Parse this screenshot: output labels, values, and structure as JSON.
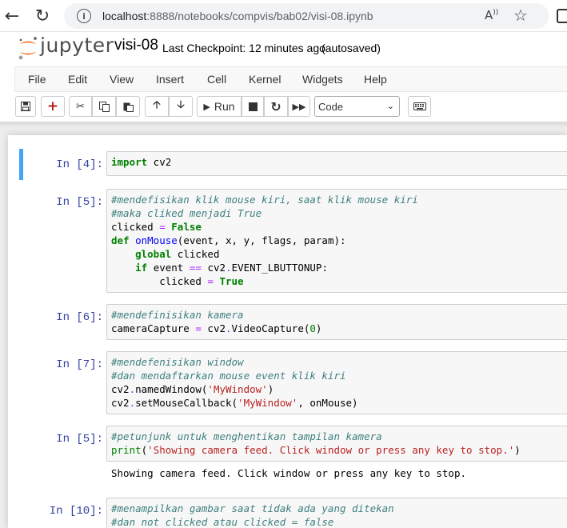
{
  "browser": {
    "url_host": "localhost",
    "url_path": ":8888/notebooks/compvis/bab02/visi-08.ipynb"
  },
  "header": {
    "logo_text": "jupyter",
    "notebook_name": "visi-08",
    "checkpoint": "Last Checkpoint: 12 minutes ago",
    "save_status": "(autosaved)"
  },
  "menu": [
    "File",
    "Edit",
    "View",
    "Insert",
    "Cell",
    "Kernel",
    "Widgets",
    "Help"
  ],
  "toolbar": {
    "run_label": "Run",
    "cell_type": "Code"
  },
  "cells": [
    {
      "prompt": "In [4]:",
      "lines": [
        [
          [
            "k",
            "import"
          ],
          [
            "",
            " cv2"
          ]
        ]
      ]
    },
    {
      "prompt": "In [5]:",
      "lines": [
        [
          [
            "c",
            "#mendefisikan klik mouse kiri, saat klik mouse kiri"
          ]
        ],
        [
          [
            "c",
            "#maka cliked menjadi True"
          ]
        ],
        [
          [
            "",
            "clicked "
          ],
          [
            "o",
            "="
          ],
          [
            "",
            " "
          ],
          [
            "k",
            "False"
          ]
        ],
        [
          [
            "k",
            "def"
          ],
          [
            "",
            " "
          ],
          [
            "f",
            "onMouse"
          ],
          [
            "",
            "(event, x, y, flags, param):"
          ]
        ],
        [
          [
            "",
            "    "
          ],
          [
            "k",
            "global"
          ],
          [
            "",
            " clicked"
          ]
        ],
        [
          [
            "",
            "    "
          ],
          [
            "k",
            "if"
          ],
          [
            "",
            " event "
          ],
          [
            "o",
            "=="
          ],
          [
            "",
            " cv2"
          ],
          [
            "o",
            "."
          ],
          [
            "",
            "EVENT_LBUTTONUP:"
          ]
        ],
        [
          [
            "",
            "        clicked "
          ],
          [
            "o",
            "="
          ],
          [
            "",
            " "
          ],
          [
            "k",
            "True"
          ]
        ]
      ]
    },
    {
      "prompt": "In [6]:",
      "lines": [
        [
          [
            "c",
            "#mendefinisikan kamera"
          ]
        ],
        [
          [
            "",
            "cameraCapture "
          ],
          [
            "o",
            "="
          ],
          [
            "",
            " cv2"
          ],
          [
            "o",
            "."
          ],
          [
            "",
            "VideoCapture("
          ],
          [
            "n",
            "0"
          ],
          [
            "",
            ")"
          ]
        ]
      ]
    },
    {
      "prompt": "In [7]:",
      "lines": [
        [
          [
            "c",
            "#mendefenisikan window"
          ]
        ],
        [
          [
            "c",
            "#dan mendaftarkan mouse event klik kiri"
          ]
        ],
        [
          [
            "",
            "cv2"
          ],
          [
            "o",
            "."
          ],
          [
            "",
            "namedWindow("
          ],
          [
            "s",
            "'MyWindow'"
          ],
          [
            "",
            ")"
          ]
        ],
        [
          [
            "",
            "cv2"
          ],
          [
            "o",
            "."
          ],
          [
            "",
            "setMouseCallback("
          ],
          [
            "s",
            "'MyWindow'"
          ],
          [
            "",
            ", onMouse)"
          ]
        ]
      ]
    },
    {
      "prompt": "In [5]:",
      "lines": [
        [
          [
            "c",
            "#petunjunk untuk menghentikan tampilan kamera"
          ]
        ],
        [
          [
            "n",
            "print"
          ],
          [
            "",
            "("
          ],
          [
            "s",
            "'Showing camera feed. Click window or press any key to stop.'"
          ],
          [
            "",
            ")"
          ]
        ]
      ],
      "output": "Showing camera feed. Click window or press any key to stop."
    },
    {
      "prompt": "In [10]:",
      "lines": [
        [
          [
            "c",
            "#menampilkan gambar saat tidak ada yang ditekan"
          ]
        ],
        [
          [
            "c",
            "#dan not clicked atau clicked = false"
          ]
        ]
      ]
    }
  ]
}
